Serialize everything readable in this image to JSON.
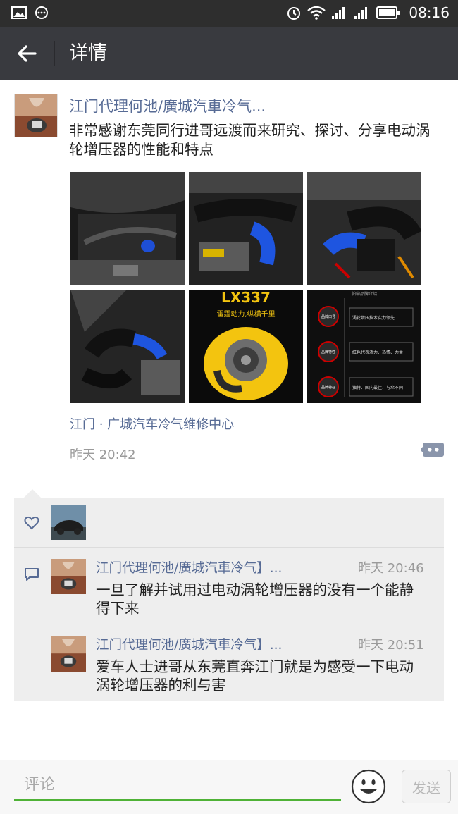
{
  "status_bar": {
    "time": "08:16"
  },
  "header": {
    "title": "详情"
  },
  "post": {
    "author": "江门代理何池/廣城汽車冷气...",
    "text": "非常感谢东莞同行进哥远渡而来研究、探讨、分享电动涡轮增压器的性能和特点",
    "photos": [
      {
        "name": "engine-bay-photo-1"
      },
      {
        "name": "engine-bay-photo-2"
      },
      {
        "name": "engine-bay-photo-3"
      },
      {
        "name": "engine-bay-photo-4"
      },
      {
        "name": "turbo-product-poster"
      },
      {
        "name": "brand-info-poster"
      }
    ],
    "poster_title": "LX337",
    "poster_tagline": "雷霆动力,纵横千里",
    "info_poster": {
      "header": "帕申品牌介绍",
      "badges": [
        "品牌口号",
        "品牌特性",
        "品牌特征"
      ],
      "lines": [
        "涡轮增压技术实力领先",
        "红色代表活力、热情、力量",
        "独特、国内最佳、与众不同"
      ]
    },
    "location": "江门 · 广城汽车冷气维修中心",
    "time": "昨天 20:42"
  },
  "comments": [
    {
      "author": "江门代理何池/廣城汽車冷气】...",
      "time": "昨天 20:46",
      "text": "一旦了解并试用过电动涡轮增压器的没有一个能静得下来"
    },
    {
      "author": "江门代理何池/廣城汽車冷气】...",
      "time": "昨天 20:51",
      "text": "爱车人士进哥从东莞直奔江门就是为感受一下电动涡轮增压器的利与害"
    }
  ],
  "bottom": {
    "placeholder": "评论",
    "send_label": "发送"
  },
  "colors": {
    "link": "#576b95",
    "titlebar": "#393a3f",
    "statusbar": "#2e2e2e",
    "accent": "#4fb236"
  }
}
